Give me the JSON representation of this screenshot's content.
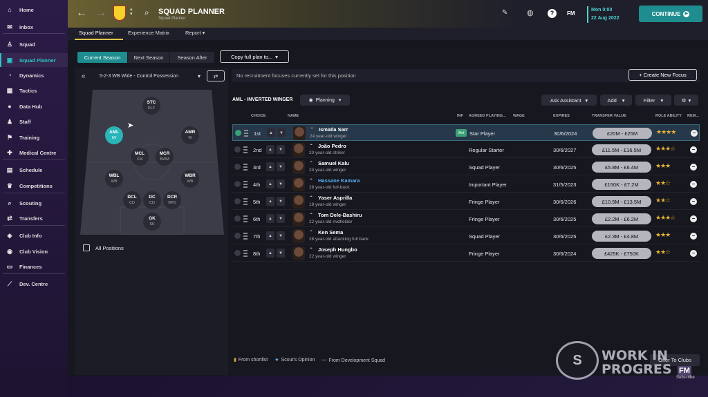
{
  "sidebar": {
    "items": [
      {
        "label": "Home",
        "icon": "home-icon",
        "glyph": "⌂"
      },
      {
        "label": "Inbox",
        "icon": "inbox-icon",
        "glyph": "✉"
      },
      {
        "label": "Squad",
        "icon": "shirt-icon",
        "glyph": "♙"
      },
      {
        "label": "Squad Planner",
        "icon": "planner-icon",
        "glyph": "▣"
      },
      {
        "label": "Dynamics",
        "icon": "dynamics-icon",
        "glyph": "◔"
      },
      {
        "label": "Tactics",
        "icon": "tactics-icon",
        "glyph": "▦"
      },
      {
        "label": "Data Hub",
        "icon": "data-hub-icon",
        "glyph": "●"
      },
      {
        "label": "Staff",
        "icon": "staff-icon",
        "glyph": "♟"
      },
      {
        "label": "Training",
        "icon": "training-icon",
        "glyph": "⚑"
      },
      {
        "label": "Medical Centre",
        "icon": "medical-icon",
        "glyph": "✚"
      },
      {
        "label": "Schedule",
        "icon": "calendar-icon",
        "glyph": "▤"
      },
      {
        "label": "Competitions",
        "icon": "trophy-icon",
        "glyph": "♛"
      },
      {
        "label": "Scouting",
        "icon": "scouting-icon",
        "glyph": "⌕"
      },
      {
        "label": "Transfers",
        "icon": "transfers-icon",
        "glyph": "⇄"
      },
      {
        "label": "Club Info",
        "icon": "club-shield-icon",
        "glyph": "◈"
      },
      {
        "label": "Club Vision",
        "icon": "vision-icon",
        "glyph": "◉"
      },
      {
        "label": "Finances",
        "icon": "finances-icon",
        "glyph": "▭"
      },
      {
        "label": "Dev. Centre",
        "icon": "dev-centre-icon",
        "glyph": "⟋"
      }
    ]
  },
  "header": {
    "title": "SQUAD PLANNER",
    "subtitle": "Squad Planner",
    "time": "Mon 0:00",
    "date": "22 Aug 2022",
    "continue_label": "CONTINUE",
    "fm_label": "FM",
    "tabs": [
      "Squad Planner",
      "Experience Matrix",
      "Report"
    ]
  },
  "season_tabs": [
    "Current Season",
    "Next Season",
    "Season After"
  ],
  "copy_plan_label": "Copy full plan to...",
  "formation": {
    "label": "5-2-3 WB Wide - Control Possession",
    "positions": [
      {
        "code": "STC",
        "role": "DLF",
        "selected": false
      },
      {
        "code": "AML",
        "role": "IW",
        "selected": true
      },
      {
        "code": "AMR",
        "role": "W",
        "selected": false
      },
      {
        "code": "MCL",
        "role": "CM",
        "selected": false
      },
      {
        "code": "MCR",
        "role": "BWM",
        "selected": false
      },
      {
        "code": "WBL",
        "role": "WB",
        "selected": false
      },
      {
        "code": "WBR",
        "role": "WB",
        "selected": false
      },
      {
        "code": "DCL",
        "role": "CD",
        "selected": false
      },
      {
        "code": "DC",
        "role": "CD",
        "selected": false
      },
      {
        "code": "DCR",
        "role": "BPD",
        "selected": false
      },
      {
        "code": "GK",
        "role": "SK",
        "selected": false
      }
    ],
    "all_positions_label": "All Positions"
  },
  "focus_message": "No recruitment focuses currently set for this position",
  "create_focus_label": "+ Create New Focus",
  "role_title": "AML - INVERTED WINGER",
  "planning_label": "Planning",
  "toolbar": {
    "ask_assistant": "Ask Assistant",
    "add": "Add",
    "filter": "Filter"
  },
  "columns": [
    "CHOICE",
    "NAME",
    "INF",
    "AGREED PLAYING...",
    "WAGE",
    "EXPIRES",
    "TRANSFER VALUE",
    "ROLE ABILITY",
    "REM..."
  ],
  "players": [
    {
      "choice": "1st",
      "name": "Ismaïla Sarr",
      "desc": "24 year-old winger",
      "inf": "Wnt",
      "playing": "Star Player",
      "expires": "30/6/2024",
      "value": "£20M - £25M",
      "stars": 4.0,
      "stars_display": "★★★★",
      "selected": true,
      "highlight": false
    },
    {
      "choice": "2nd",
      "name": "João Pedro",
      "desc": "20 year-old striker",
      "inf": "",
      "playing": "Regular Starter",
      "expires": "30/6/2027",
      "value": "£11.5M - £16.5M",
      "stars": 3.5,
      "stars_display": "★★★☆",
      "selected": false,
      "highlight": false
    },
    {
      "choice": "3rd",
      "name": "Samuel Kalu",
      "desc": "24 year-old winger",
      "inf": "",
      "playing": "Squad Player",
      "expires": "30/6/2025",
      "value": "£5.8M - £6.4M",
      "stars": 3.0,
      "stars_display": "★★★",
      "selected": false,
      "highlight": false
    },
    {
      "choice": "4th",
      "name": "Hassane Kamara",
      "desc": "28 year-old full-back",
      "inf": "",
      "playing": "Important Player",
      "expires": "31/5/2023",
      "value": "£150K - £7.2M",
      "stars": 2.5,
      "stars_display": "★★☆",
      "selected": false,
      "highlight": true
    },
    {
      "choice": "5th",
      "name": "Yaser Asprilla",
      "desc": "18 year-old winger",
      "inf": "",
      "playing": "Fringe Player",
      "expires": "30/6/2026",
      "value": "£10.5M - £13.5M",
      "stars": 2.5,
      "stars_display": "★★☆",
      "selected": false,
      "highlight": false
    },
    {
      "choice": "6th",
      "name": "Tom Dele-Bashiru",
      "desc": "22 year-old midfielder",
      "inf": "",
      "playing": "Fringe Player",
      "expires": "30/6/2025",
      "value": "£2.2M - £6.2M",
      "stars": 3.0,
      "stars_display": "★★★☆",
      "selected": false,
      "highlight": false
    },
    {
      "choice": "7th",
      "name": "Ken Sema",
      "desc": "28 year-old attacking full back",
      "inf": "",
      "playing": "Squad Player",
      "expires": "30/6/2025",
      "value": "£2.3M - £4.8M",
      "stars": 3.0,
      "stars_display": "★★★",
      "selected": false,
      "highlight": false
    },
    {
      "choice": "8th",
      "name": "Joseph Hungbo",
      "desc": "22 year-old winger",
      "inf": "",
      "playing": "Fringe Player",
      "expires": "30/6/2024",
      "value": "£425K - £750K",
      "stars": 2.0,
      "stars_display": "★★☆",
      "selected": false,
      "highlight": false
    }
  ],
  "legend": [
    {
      "icon": "shortlist-icon",
      "glyph": "▮",
      "label": "From shortlist",
      "color": "#d9a640"
    },
    {
      "icon": "star-icon",
      "glyph": "★",
      "label": "Scout's Opinion",
      "color": "#5ab0f0"
    },
    {
      "icon": "development-icon",
      "glyph": "〰",
      "label": "From Development Squad",
      "color": "#6fbfbf"
    }
  ],
  "offer_label": "Offer To Clubs",
  "watermark": {
    "seal": "S",
    "text_line1": "WORK IN",
    "text_line2": "PROGRES",
    "fm": "FM",
    "subscribe": "Subscribe"
  },
  "colors": {
    "accent": "#2cc6c6",
    "continue": "#1f8d8f",
    "star": "#e7b234",
    "selected_row": "#26384a"
  }
}
